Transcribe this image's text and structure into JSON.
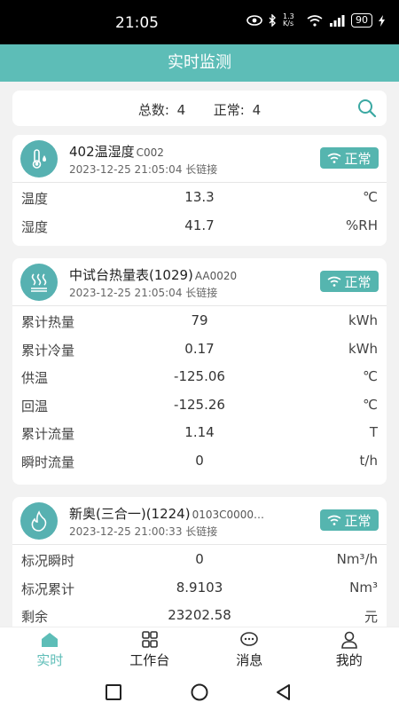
{
  "status": {
    "time": "21:05",
    "net_speed": "1.3 K/s",
    "battery": "90"
  },
  "header": {
    "title": "实时监测"
  },
  "summary": {
    "total_label": "总数:",
    "total_value": "4",
    "normal_label": "正常:",
    "normal_value": "4"
  },
  "cards": [
    {
      "name": "402温湿度",
      "code": "C002",
      "time": "2023-12-25 21:05:04 长链接",
      "status": "正常",
      "icon": "thermometer-icon",
      "rows": [
        {
          "label": "温度",
          "value": "13.3",
          "unit": "℃"
        },
        {
          "label": "湿度",
          "value": "41.7",
          "unit": "%RH"
        }
      ]
    },
    {
      "name": "中试台热量表(1029)",
      "code": "AA0020",
      "time": "2023-12-25 21:05:04 长链接",
      "status": "正常",
      "icon": "heat-icon",
      "rows": [
        {
          "label": "累计热量",
          "value": "79",
          "unit": "kWh"
        },
        {
          "label": "累计冷量",
          "value": "0.17",
          "unit": "kWh"
        },
        {
          "label": "供温",
          "value": "-125.06",
          "unit": "℃"
        },
        {
          "label": "回温",
          "value": "-125.26",
          "unit": "℃"
        },
        {
          "label": "累计流量",
          "value": "1.14",
          "unit": "T"
        },
        {
          "label": "瞬时流量",
          "value": "0",
          "unit": "t/h"
        }
      ]
    },
    {
      "name": "新奥(三合一)(1224)",
      "code": "0103C0000…",
      "time": "2023-12-25 21:00:33 长链接",
      "status": "正常",
      "icon": "flame-icon",
      "rows": [
        {
          "label": "标况瞬时",
          "value": "0",
          "unit": "Nm³/h"
        },
        {
          "label": "标况累计",
          "value": "8.9103",
          "unit": "Nm³"
        },
        {
          "label": "剩余",
          "value": "23202.58",
          "unit": "元"
        }
      ]
    }
  ],
  "tabs": [
    {
      "label": "实时",
      "icon": "home-icon",
      "active": true
    },
    {
      "label": "工作台",
      "icon": "grid-icon",
      "active": false
    },
    {
      "label": "消息",
      "icon": "chat-icon",
      "active": false
    },
    {
      "label": "我的",
      "icon": "user-icon",
      "active": false
    }
  ],
  "colors": {
    "accent": "#5dbdb7",
    "icon_bg": "#57b1b1",
    "badge": "#55b5af"
  }
}
